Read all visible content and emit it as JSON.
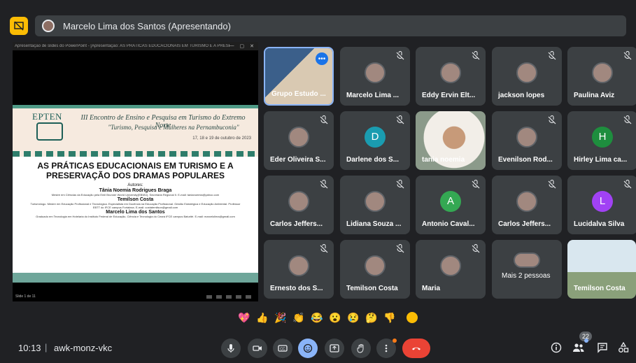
{
  "topbar": {
    "presenter_label": "Marcelo Lima dos Santos (Apresentando)"
  },
  "screen": {
    "window_title": "Apresentação de slides do PowerPoint - [Apresentação: AS PRÁTICAS EDUCACIONAIS EM TURISMO E A PRESE...",
    "slide": {
      "logo_text": "EPTEN",
      "event_title": "III Encontro de Ensino e Pesquisa em Turismo do Extremo Norte",
      "event_subtitle": "\"Turismo, Pesquisa e Mulheres na Pernambuconia\"",
      "event_date": "17, 18 e 19 de outubro de 2023",
      "title_line1": "AS PRÁTICAS EDUCACIONAIS EM TURISMO E A",
      "title_line2": "PRESERVAÇÃO DOS DRAMAS POPULARES",
      "authors_label": "Autores:",
      "author1": "Tânia Noemia Rodrigues Braga",
      "author1_desc": "Mestre em Ciências da Educação pela Emil Brunner World University(EBWU), Secretaria Regional II. E-mail: tanianoemia@yahoo.com",
      "author2": "Temilson Costa",
      "author2_desc": "Turismólogo. Mestre em Educação Profissional e Tecnológica. Especialista em Docência na Educação Profissional. Gestão Estratégica e Educação Ambiental. Professor EBTT do IFCE campus Fortaleza. E-mail: costatemilson@gmail.com",
      "author3": "Marcelo Lima dos Santos",
      "author3_desc": "Graduado em Tecnologia em Hotelaria do Instituto Federal de Educação, Ciência e Tecnologia do Ceará IFCE campus Baturité. E-mail: marcelolima@gmail.com",
      "page_indicator": "Slide 1 de 11"
    }
  },
  "participants": [
    {
      "name": "Grupo Estudo ...",
      "type": "video",
      "active": true
    },
    {
      "name": "Marcelo Lima ...",
      "type": "avatar",
      "muted": true
    },
    {
      "name": "Eddy Ervin Elt...",
      "type": "avatar",
      "muted": true
    },
    {
      "name": "jackson lopes",
      "type": "avatar",
      "muted": true
    },
    {
      "name": "Paulina Aviz",
      "type": "avatar",
      "muted": true
    },
    {
      "name": "Eder Oliveira S...",
      "type": "avatar",
      "muted": true
    },
    {
      "name": "Darlene dos S...",
      "type": "letter",
      "letter": "D",
      "color": "#1a9cb0",
      "muted": true
    },
    {
      "name": "tania noemia",
      "type": "video"
    },
    {
      "name": "Evenilson Rod...",
      "type": "avatar",
      "muted": true
    },
    {
      "name": "Hirley Lima ca...",
      "type": "letter",
      "letter": "H",
      "color": "#1e8e3e",
      "muted": true
    },
    {
      "name": "Carlos Jeffers...",
      "type": "avatar",
      "muted": true
    },
    {
      "name": "Lidiana Souza ...",
      "type": "avatar",
      "muted": true
    },
    {
      "name": "Antonio Caval...",
      "type": "letter",
      "letter": "A",
      "color": "#34a853",
      "muted": true
    },
    {
      "name": "Carlos Jeffers...",
      "type": "avatar",
      "muted": true
    },
    {
      "name": "Lucidalva Silva",
      "type": "letter",
      "letter": "L",
      "color": "#a142f4",
      "muted": true
    },
    {
      "name": "Ernesto dos S...",
      "type": "avatar",
      "muted": true
    },
    {
      "name": "Temilson Costa",
      "type": "avatar",
      "muted": true
    },
    {
      "name": "Maria",
      "type": "avatar",
      "muted": true
    },
    {
      "name": "Mais 2 pessoas",
      "type": "more"
    },
    {
      "name": "Temilson Costa",
      "type": "video"
    }
  ],
  "reactions": [
    "💖",
    "👍",
    "🎉",
    "👏",
    "😂",
    "😮",
    "😢",
    "🤔",
    "👎"
  ],
  "bottombar": {
    "time": "10:13",
    "separator": "|",
    "meeting_code": "awk-monz-vkc",
    "participant_count": "22"
  },
  "colors": {
    "background": "#202124",
    "tile": "#3c4043",
    "end_call": "#ea4335",
    "accent_blue": "#8ab4f8",
    "present_icon": "#fbbc04"
  }
}
